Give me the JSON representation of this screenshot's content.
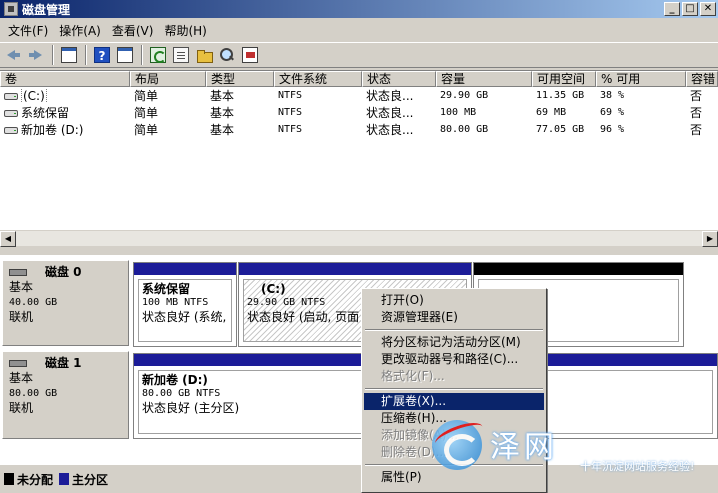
{
  "window": {
    "title": "磁盘管理"
  },
  "menu": [
    "文件(F)",
    "操作(A)",
    "查看(V)",
    "帮助(H)"
  ],
  "toolbar_icons": [
    "back-icon",
    "forward-icon",
    "console-tree-icon",
    "help-icon",
    "show-pane-icon",
    "refresh-icon",
    "properties-icon",
    "open-icon",
    "explore-icon",
    "settings-icon"
  ],
  "volume_list": {
    "columns": [
      "卷",
      "布局",
      "类型",
      "文件系统",
      "状态",
      "容量",
      "可用空间",
      "% 可用",
      "容错"
    ],
    "rows": [
      {
        "volume": "(C:)",
        "layout": "简单",
        "type": "基本",
        "fs": "NTFS",
        "status": "状态良...",
        "capacity": "29.90 GB",
        "free": "11.35 GB",
        "pct": "38 %",
        "ft": "否"
      },
      {
        "volume": "系统保留",
        "layout": "简单",
        "type": "基本",
        "fs": "NTFS",
        "status": "状态良...",
        "capacity": "100 MB",
        "free": "69 MB",
        "pct": "69 %",
        "ft": "否"
      },
      {
        "volume": "新加卷 (D:)",
        "layout": "简单",
        "type": "基本",
        "fs": "NTFS",
        "status": "状态良...",
        "capacity": "80.00 GB",
        "free": "77.05 GB",
        "pct": "96 %",
        "ft": "否"
      }
    ]
  },
  "disks": [
    {
      "name": "磁盘 0",
      "type": "基本",
      "size": "40.00 GB",
      "state": "联机",
      "partitions": [
        {
          "name": "系统保留",
          "size": "100 MB NTFS",
          "status": "状态良好 (系统,",
          "color": "#1c1c98"
        },
        {
          "name": "(C:)",
          "size": "29.90 GB NTFS",
          "status": "状态良好 (启动, 页面",
          "color": "#1c1c98"
        },
        {
          "name": "",
          "size": "",
          "status": "",
          "color": "#000000"
        }
      ]
    },
    {
      "name": "磁盘 1",
      "type": "基本",
      "size": "80.00 GB",
      "state": "联机",
      "partitions": [
        {
          "name": "新加卷 (D:)",
          "size": "80.00 GB NTFS",
          "status": "状态良好 (主分区)",
          "color": "#1c1c98"
        }
      ]
    }
  ],
  "legend": [
    {
      "label": "未分配",
      "color": "#000000"
    },
    {
      "label": "主分区",
      "color": "#1c1c98"
    }
  ],
  "context_menu": {
    "items": [
      {
        "label": "打开(O)",
        "state": "normal"
      },
      {
        "label": "资源管理器(E)",
        "state": "normal"
      },
      {
        "label": "-",
        "state": "sep"
      },
      {
        "label": "将分区标记为活动分区(M)",
        "state": "normal"
      },
      {
        "label": "更改驱动器号和路径(C)...",
        "state": "normal"
      },
      {
        "label": "格式化(F)...",
        "state": "disabled"
      },
      {
        "label": "-",
        "state": "sep"
      },
      {
        "label": "扩展卷(X)...",
        "state": "highlight"
      },
      {
        "label": "压缩卷(H)...",
        "state": "normal"
      },
      {
        "label": "添加镜像(A)...",
        "state": "disabled"
      },
      {
        "label": "删除卷(D)...",
        "state": "disabled"
      },
      {
        "label": "-",
        "state": "sep"
      },
      {
        "label": "属性(P)",
        "state": "normal"
      }
    ]
  },
  "watermark": {
    "big": "泽网",
    "small": "十年沉淀网站服务经验!"
  }
}
